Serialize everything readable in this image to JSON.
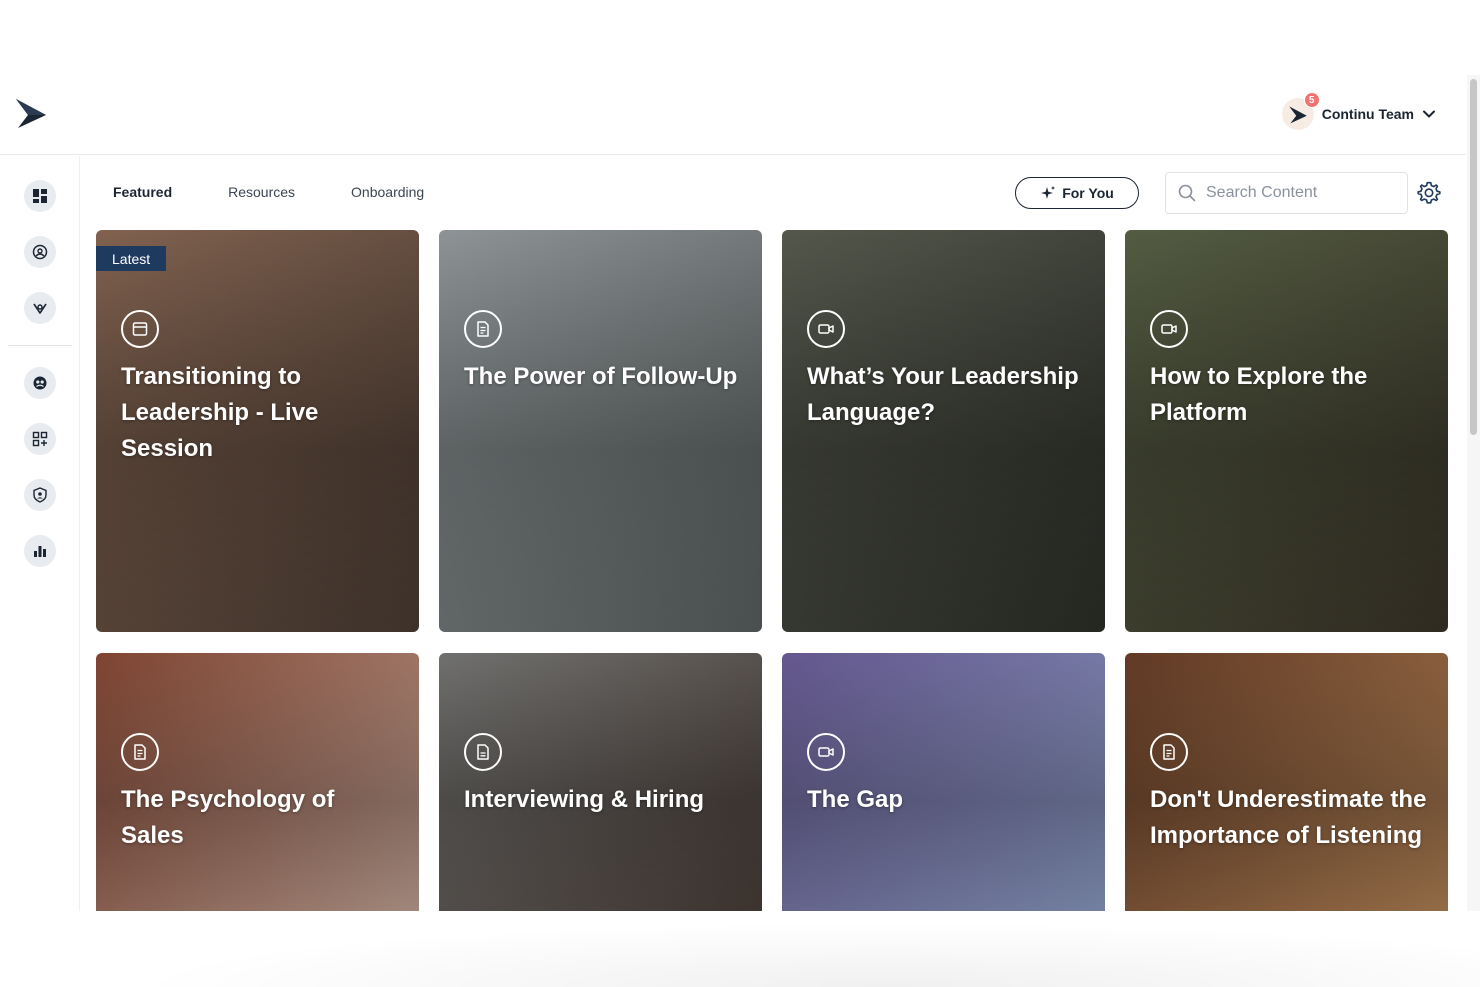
{
  "account": {
    "name": "Continu Team",
    "notifications": "5"
  },
  "tabs": [
    {
      "label": "Featured",
      "active": true
    },
    {
      "label": "Resources",
      "active": false
    },
    {
      "label": "Onboarding",
      "active": false
    }
  ],
  "for_you": {
    "label": "For You"
  },
  "search": {
    "placeholder": "Search Content"
  },
  "sidebar": {
    "items": [
      {
        "icon": "dashboard-icon"
      },
      {
        "icon": "explore-icon"
      },
      {
        "icon": "paths-icon"
      },
      {
        "icon": "people-icon"
      },
      {
        "icon": "add-content-icon"
      },
      {
        "icon": "admin-shield-icon"
      },
      {
        "icon": "analytics-icon"
      }
    ]
  },
  "cards": [
    {
      "title": "Transitioning to Leadership - Live Session",
      "type_icon": "calendar-icon",
      "badge": "Latest",
      "colors": [
        "#8c6a56",
        "#4a3c33"
      ]
    },
    {
      "title": "The Power of Follow-Up",
      "type_icon": "document-icon",
      "badge": "",
      "colors": [
        "#9aa0a3",
        "#5a6160"
      ]
    },
    {
      "title": "What’s Your Leadership Language?",
      "type_icon": "video-icon",
      "badge": "",
      "colors": [
        "#5b5f52",
        "#2c2f28"
      ]
    },
    {
      "title": "How to Explore the Platform",
      "type_icon": "video-icon",
      "badge": "",
      "colors": [
        "#5a6448",
        "#3a3428"
      ]
    },
    {
      "title": "The Psychology of Sales",
      "type_icon": "document-icon",
      "badge": "",
      "colors": [
        "#8a4a36",
        "#c8a99a"
      ]
    },
    {
      "title": "Interviewing & Hiring",
      "type_icon": "file-icon",
      "badge": "",
      "colors": [
        "#7a7a78",
        "#4a3e38"
      ]
    },
    {
      "title": "The Gap",
      "type_icon": "video-icon",
      "badge": "",
      "colors": [
        "#6d5f9a",
        "#8fa0c8"
      ]
    },
    {
      "title": "Don't Underestimate the Importance of Listening",
      "type_icon": "document-icon",
      "badge": "",
      "colors": [
        "#6a3f28",
        "#b78658"
      ]
    }
  ]
}
